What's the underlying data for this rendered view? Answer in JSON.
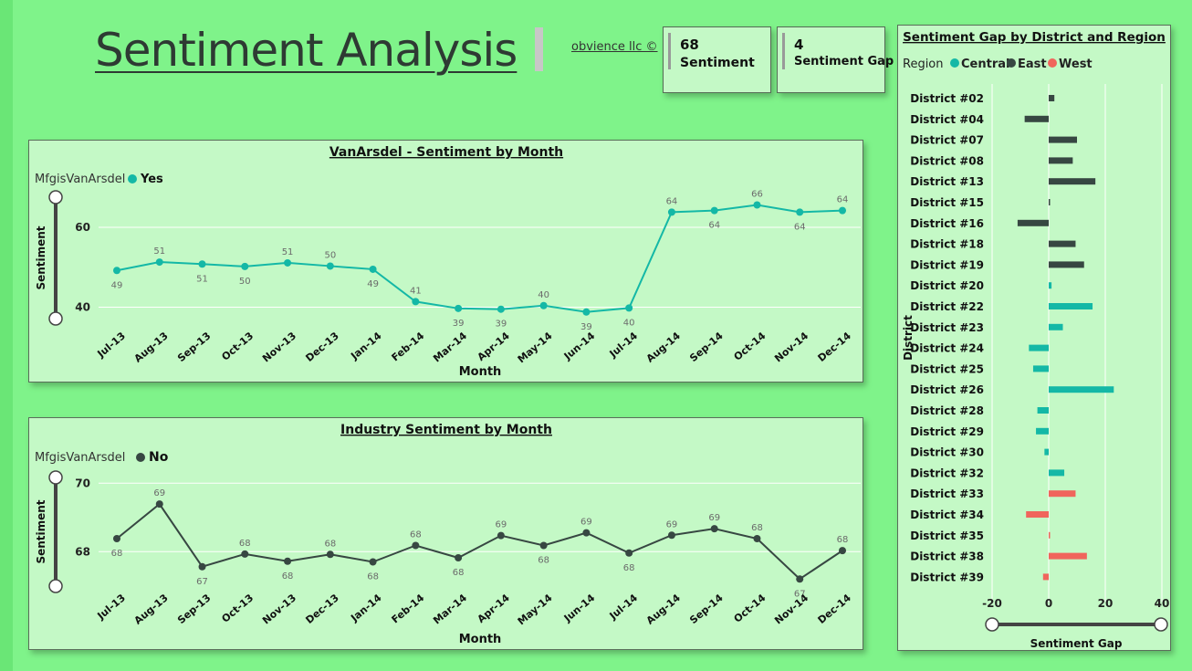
{
  "header": {
    "title": "Sentiment Analysis",
    "credit": "obvience llc ©"
  },
  "cards": [
    {
      "value": "68",
      "label": "Sentiment"
    },
    {
      "value": "4",
      "label": "Sentiment Gap"
    }
  ],
  "colors": {
    "background": "#7ff38a",
    "panel": "#c4f9c6",
    "central": "#14b8a6",
    "east": "#374742",
    "west": "#f0655c",
    "industry_line": "#374742"
  },
  "chart_data": [
    {
      "type": "line",
      "title": "VanArsdel - Sentiment by Month",
      "legend_title": "MfgisVanArsdel",
      "xlabel": "Month",
      "ylabel": "Sentiment",
      "y_ticks": [
        "40",
        "60"
      ],
      "ylim": [
        36,
        68
      ],
      "legend_position": "top-left",
      "grid": true,
      "x": [
        "Jul-13",
        "Aug-13",
        "Sep-13",
        "Oct-13",
        "Nov-13",
        "Dec-13",
        "Jan-14",
        "Feb-14",
        "Mar-14",
        "Apr-14",
        "May-14",
        "Jun-14",
        "Jul-14",
        "Aug-14",
        "Sep-14",
        "Oct-14",
        "Nov-14",
        "Dec-14"
      ],
      "series": [
        {
          "name": "Yes",
          "values": [
            49.2,
            51.3,
            50.8,
            50.2,
            51.1,
            50.3,
            49.5,
            41.4,
            39.7,
            39.5,
            40.4,
            38.8,
            39.8,
            63.8,
            64.2,
            65.6,
            63.8,
            64.2
          ],
          "labels": [
            "49",
            "51",
            "51",
            "50",
            "51",
            "50",
            "49",
            "41",
            "39",
            "39",
            "40",
            "39",
            "40",
            "64",
            "64",
            "66",
            "64",
            "64"
          ]
        }
      ]
    },
    {
      "type": "line",
      "title": "Industry Sentiment by Month",
      "legend_title": "MfgisVanArsdel",
      "xlabel": "Month",
      "ylabel": "Sentiment",
      "y_ticks": [
        "68",
        "70"
      ],
      "ylim": [
        66.7,
        70.3
      ],
      "legend_position": "top-left",
      "grid": true,
      "x": [
        "Jul-13",
        "Aug-13",
        "Sep-13",
        "Oct-13",
        "Nov-13",
        "Dec-13",
        "Jan-14",
        "Feb-14",
        "Mar-14",
        "Apr-14",
        "May-14",
        "Jun-14",
        "Jul-14",
        "Aug-14",
        "Sep-14",
        "Oct-14",
        "Nov-14",
        "Dec-14"
      ],
      "series": [
        {
          "name": "No",
          "values": [
            68.38,
            69.39,
            67.56,
            67.93,
            67.72,
            67.92,
            67.7,
            68.18,
            67.82,
            68.47,
            68.18,
            68.55,
            67.96,
            68.48,
            68.67,
            68.38,
            67.2,
            68.03
          ],
          "labels": [
            "68",
            "69",
            "67",
            "68",
            "68",
            "68",
            "68",
            "68",
            "68",
            "69",
            "68",
            "69",
            "68",
            "69",
            "69",
            "68",
            "67",
            "68"
          ]
        }
      ]
    },
    {
      "type": "bar",
      "orientation": "horizontal",
      "title": "Sentiment Gap by District and Region",
      "legend_title": "Region",
      "legend": [
        "Central",
        "East",
        "West"
      ],
      "legend_position": "top-left",
      "xlabel": "Sentiment Gap",
      "ylabel": "District",
      "xlim": [
        -20,
        40
      ],
      "x_ticks": [
        "-20",
        "0",
        "20",
        "40"
      ],
      "grid": true,
      "categories": [
        "District #02",
        "District #04",
        "District #07",
        "District #08",
        "District #13",
        "District #15",
        "District #16",
        "District #18",
        "District #19",
        "District #20",
        "District #22",
        "District #23",
        "District #24",
        "District #25",
        "District #26",
        "District #28",
        "District #29",
        "District #30",
        "District #32",
        "District #33",
        "District #34",
        "District #35",
        "District #38",
        "District #39"
      ],
      "values": [
        2,
        -8.5,
        10,
        8.5,
        16.5,
        0.3,
        -11,
        9.5,
        12.5,
        1,
        15.5,
        5,
        -7,
        -5.5,
        23,
        -4,
        -4.5,
        -1.5,
        5.5,
        9.5,
        -8,
        0.3,
        13.5,
        -2
      ],
      "regions": [
        "East",
        "East",
        "East",
        "East",
        "East",
        "East",
        "East",
        "East",
        "East",
        "Central",
        "Central",
        "Central",
        "Central",
        "Central",
        "Central",
        "Central",
        "Central",
        "Central",
        "Central",
        "West",
        "West",
        "West",
        "West",
        "West"
      ]
    }
  ]
}
